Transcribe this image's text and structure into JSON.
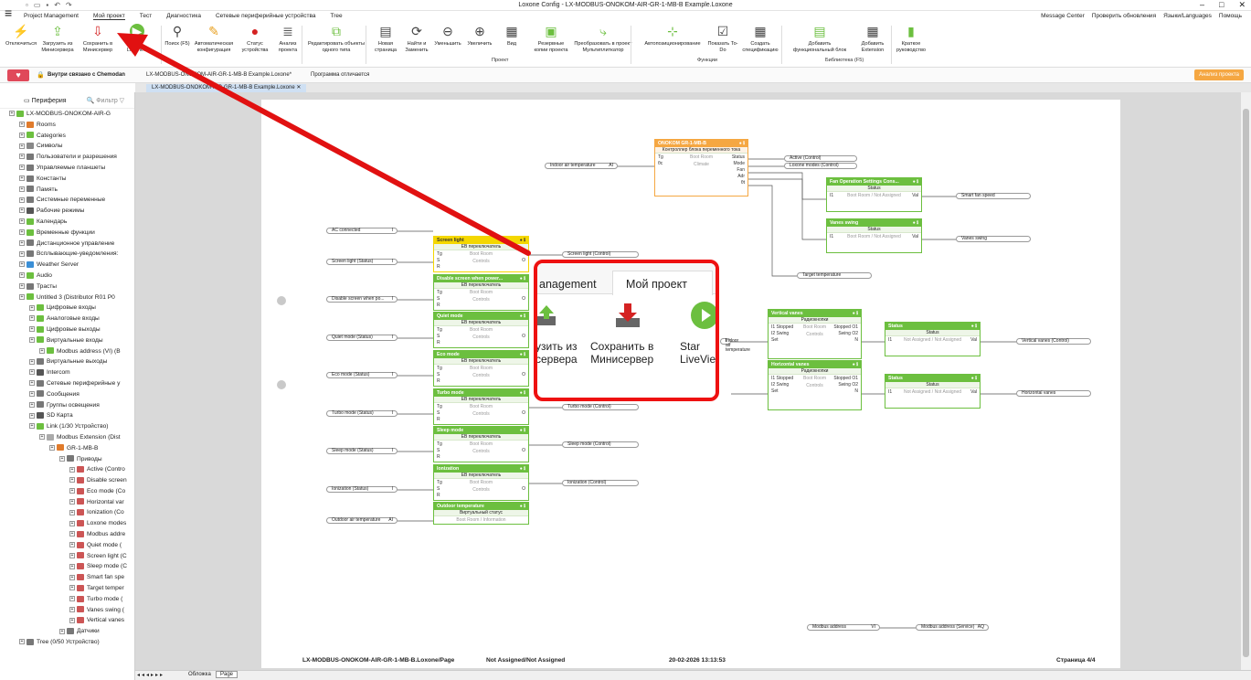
{
  "window": {
    "title": "Loxone Config - LX-MODBUS-ONOKOM-AIR-GR-1-MB-B Example.Loxone"
  },
  "menu": {
    "tabs": [
      "Project Management",
      "Мой проект",
      "Тест",
      "Диагностика",
      "Сетевые периферийные устройства",
      "Tree"
    ],
    "right": [
      "Message Center",
      "Проверить обновления",
      "Языки/Languages",
      "Помощь"
    ]
  },
  "ribbon": {
    "buttons": [
      "Отключиться",
      "Загрузить из Минисервера",
      "Сохранить в Минисервер",
      "Start LiveView",
      "Поиск (F5)",
      "Автоматическая конфигурация",
      "Статус устройства",
      "Анализ проекта",
      "Редактировать объекты одного типа",
      "Новая страница",
      "Найти и Заменить",
      "Уменьшить",
      "Увеличить",
      "Вид",
      "Резервные копии проекта",
      "Преобразовать в проект Мультиплиткатор",
      "Автопозиционирование",
      "Показать To-Do",
      "Создать спецификацию",
      "Добавить функциональный блок",
      "Добавить Extension",
      "Краткое руководство"
    ],
    "groups": [
      "Проект",
      "Функции",
      "Библиотека (F5)"
    ]
  },
  "statusbar": {
    "connection": "Внутри связано с Chemodan",
    "project": "LX-MODBUS-ONOKOM-AIR-GR-1-MB-B Example.Loxone*",
    "diff": "Программа отличается",
    "analyze": "Анализ проекта"
  },
  "doctab": "LX-MODBUS-ONOKOM-AIR-GR-1-MB-B Example.Loxone",
  "sidebar": {
    "title": "Периферия",
    "filter": "Фильтр",
    "items": [
      {
        "l": "LX-MODBUS-ONOKOM-AIR-G",
        "d": 0,
        "c": "#6cbf3f"
      },
      {
        "l": "Rooms",
        "d": 1,
        "c": "#e07b2c"
      },
      {
        "l": "Categories",
        "d": 1,
        "c": "#6cbf3f"
      },
      {
        "l": "Символы",
        "d": 1,
        "c": "#888"
      },
      {
        "l": "Пользователи и разрешения",
        "d": 1,
        "c": "#777"
      },
      {
        "l": "Управляемые планшеты",
        "d": 1,
        "c": "#777"
      },
      {
        "l": "Константы",
        "d": 1,
        "c": "#777"
      },
      {
        "l": "Память",
        "d": 1,
        "c": "#777"
      },
      {
        "l": "Системные переменные",
        "d": 1,
        "c": "#777"
      },
      {
        "l": "Рабочие режимы",
        "d": 1,
        "c": "#555"
      },
      {
        "l": "Календарь",
        "d": 1,
        "c": "#6cbf3f"
      },
      {
        "l": "Временные функции",
        "d": 1,
        "c": "#6cbf3f"
      },
      {
        "l": "Дистанционное управление",
        "d": 1,
        "c": "#777"
      },
      {
        "l": "Всплывающие-уведомления:",
        "d": 1,
        "c": "#777"
      },
      {
        "l": "Weather Server",
        "d": 1,
        "c": "#3b8fd6"
      },
      {
        "l": "Audio",
        "d": 1,
        "c": "#6cbf3f"
      },
      {
        "l": "Трасты",
        "d": 1,
        "c": "#777"
      },
      {
        "l": "Untitled 3 (Distributor R01 P0",
        "d": 1,
        "c": "#6cbf3f"
      },
      {
        "l": "Цифровые входы",
        "d": 2,
        "c": "#6cbf3f"
      },
      {
        "l": "Аналоговые входы",
        "d": 2,
        "c": "#6cbf3f"
      },
      {
        "l": "Цифровые выходы",
        "d": 2,
        "c": "#6cbf3f"
      },
      {
        "l": "Виртуальные входы",
        "d": 2,
        "c": "#6cbf3f"
      },
      {
        "l": "Modbus address (VI) (B",
        "d": 3,
        "c": "#6cbf3f"
      },
      {
        "l": "Виртуальные выходы",
        "d": 2,
        "c": "#777"
      },
      {
        "l": "Intercom",
        "d": 2,
        "c": "#555"
      },
      {
        "l": "Сетевые периферийные у",
        "d": 2,
        "c": "#777"
      },
      {
        "l": "Сообщения",
        "d": 2,
        "c": "#777"
      },
      {
        "l": "Группы освещения",
        "d": 2,
        "c": "#777"
      },
      {
        "l": "SD Карта",
        "d": 2,
        "c": "#555"
      },
      {
        "l": "Link (1/30 Устройство)",
        "d": 2,
        "c": "#6cbf3f"
      },
      {
        "l": "Modbus Extension (Dist",
        "d": 3,
        "c": "#aaa"
      },
      {
        "l": "GR-1-MB-B",
        "d": 4,
        "c": "#e07b2c"
      },
      {
        "l": "Приводы",
        "d": 5,
        "c": "#777"
      },
      {
        "l": "Active (Contro",
        "d": 6,
        "c": "#c55"
      },
      {
        "l": "Disable screen",
        "d": 6,
        "c": "#c55"
      },
      {
        "l": "Eco mode (Co",
        "d": 6,
        "c": "#c55"
      },
      {
        "l": "Horizontal var",
        "d": 6,
        "c": "#c55"
      },
      {
        "l": "Ionization (Co",
        "d": 6,
        "c": "#c55"
      },
      {
        "l": "Loxone modes",
        "d": 6,
        "c": "#c55"
      },
      {
        "l": "Modbus addre",
        "d": 6,
        "c": "#c55"
      },
      {
        "l": "Quiet mode (",
        "d": 6,
        "c": "#c55"
      },
      {
        "l": "Screen light (C",
        "d": 6,
        "c": "#c55"
      },
      {
        "l": "Sleep mode (C",
        "d": 6,
        "c": "#c55"
      },
      {
        "l": "Smart fan spe",
        "d": 6,
        "c": "#c55"
      },
      {
        "l": "Target temper",
        "d": 6,
        "c": "#c55"
      },
      {
        "l": "Turbo mode (",
        "d": 6,
        "c": "#c55"
      },
      {
        "l": "Vanes swing (",
        "d": 6,
        "c": "#c55"
      },
      {
        "l": "Vertical vanes",
        "d": 6,
        "c": "#c55"
      },
      {
        "l": "Датчики",
        "d": 5,
        "c": "#777"
      },
      {
        "l": "Tree (0/50 Устройство)",
        "d": 1,
        "c": "#777"
      }
    ]
  },
  "diagram": {
    "onokom": {
      "title": "ONOKOM GR-1-MB-B",
      "sub": "Контроллер блока переменного тока",
      "in": [
        "Tg",
        "θc"
      ],
      "room": "Boot Room",
      "cat": "Climate",
      "out": [
        "Status",
        "Mode",
        "Fan",
        "Adr",
        "θt"
      ]
    },
    "fan": {
      "title": "Fan Operation Settings Cons...",
      "sub": "Status",
      "in": "I1",
      "room": "Boot Room / Not Assigned",
      "out": "Val"
    },
    "vswing": {
      "title": "Vanes swing",
      "sub": "Status",
      "in": "I1",
      "room": "Boot Room / Not Assigned",
      "out": "Val"
    },
    "vvanes": {
      "title": "Vertical vanes",
      "sub": "Радиокнопки",
      "in": [
        "I1 Stopped",
        "I2 Swing",
        "Set"
      ],
      "room": "Boot Room",
      "cat": "Controls",
      "out": [
        "Stopped O1",
        "Swing O2",
        "N"
      ]
    },
    "hvanes": {
      "title": "Horizontal vanes",
      "sub": "Радиокнопки",
      "in": [
        "I1 Stopped",
        "I2 Swing",
        "Set"
      ],
      "room": "Boot Room",
      "cat": "Controls",
      "out": [
        "Stopped O1",
        "Swing O2",
        "N"
      ]
    },
    "status1": {
      "title": "Status",
      "sub": "Status",
      "in": "I1",
      "room": "Not Assigned / Not Assigned",
      "out": "Val"
    },
    "status2": {
      "title": "Status",
      "sub": "Status",
      "in": "I1",
      "room": "Not Assigned / Not Assigned",
      "out": "Val"
    },
    "left_blocks": [
      {
        "t": "Screen light"
      },
      {
        "t": "Disable screen when power..."
      },
      {
        "t": "Quiet mode"
      },
      {
        "t": "Eco mode"
      },
      {
        "t": "Turbo mode"
      },
      {
        "t": "Sleep mode"
      },
      {
        "t": "Ionization"
      }
    ],
    "left_block_sub": "ЕВ переключатель",
    "left_room": "Boot Room",
    "left_cat": "Controls",
    "outdoor": {
      "title": "Outdoor temperature",
      "sub": "Виртуальный статус",
      "room": "Boot Room / Information"
    },
    "inputs": [
      "AC connected",
      "Screen light (Status)",
      "Disable screen when po...",
      "Quiet mode (Status)",
      "Eco mode (Status)",
      "Turbo mode (Status)",
      "Sleep mode (Status)",
      "Ionization (Status)",
      "Outdoor air temperature"
    ],
    "outputs": [
      "Screen light (Control)",
      "Turbo mode (Control)",
      "Sleep mode (Control)",
      "Ionization (Control)"
    ],
    "right_outputs": [
      "Active (Control)",
      "Loxone modes (Control)",
      "Smart fan speed",
      "Vanes swing",
      "Target temperature",
      "Vertical vanes (Control)",
      "Horizontal vanes"
    ],
    "indoor": "Indoor air temperature",
    "modbus_in": "Modbus address",
    "modbus_out": "Modbus address (Service)"
  },
  "footer": {
    "project": "LX-MODBUS-ONOKOM-AIR-GR-1-MB-B.Loxone/Page",
    "assign": "Not Assigned/Not Assigned",
    "date": "20-02-2026 13:13:53",
    "page": "Страница 4/4"
  },
  "bottomtabs": [
    "Обложка",
    "Page"
  ],
  "zoom": {
    "tab1": "anagement",
    "tab2": "Мой проект",
    "btn1": "узить из\nсервера",
    "btn2": "Сохранить в\nМинисервер",
    "btn3": "Star\nLiveVie"
  },
  "colors": {
    "accent": "#6cbf3f",
    "arrow": "#e11111",
    "header_yellow": "#f4d700",
    "header_orange": "#f5a742"
  }
}
